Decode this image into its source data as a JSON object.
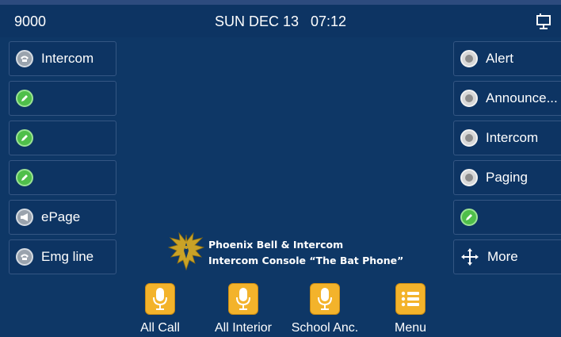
{
  "status_bar": {
    "extension": "9000",
    "datetime": "SUN DEC 13   07:12",
    "network_icon": "network-connected-icon"
  },
  "left_keys": [
    {
      "label": "Intercom",
      "icon": "phone-icon",
      "style": "grey"
    },
    {
      "label": "",
      "icon": "edit-icon",
      "style": "green"
    },
    {
      "label": "",
      "icon": "edit-icon",
      "style": "green"
    },
    {
      "label": "",
      "icon": "edit-icon",
      "style": "green"
    },
    {
      "label": "ePage",
      "icon": "megaphone-icon",
      "style": "grey"
    },
    {
      "label": "Emg line",
      "icon": "phone-icon",
      "style": "grey"
    }
  ],
  "right_keys": [
    {
      "label": "Alert",
      "icon": "radio-icon",
      "style": "white"
    },
    {
      "label": "Announce...",
      "icon": "radio-icon",
      "style": "white"
    },
    {
      "label": "Intercom",
      "icon": "radio-icon",
      "style": "white"
    },
    {
      "label": "Paging",
      "icon": "radio-icon",
      "style": "white"
    },
    {
      "label": "",
      "icon": "edit-icon",
      "style": "green"
    },
    {
      "label": "More",
      "icon": "move-arrows-icon",
      "style": "none"
    }
  ],
  "branding": {
    "line1": "Phoenix Bell & Intercom",
    "line2": "Intercom Console “The Bat Phone”"
  },
  "softkeys": [
    {
      "label": "All Call",
      "icon": "microphone-icon"
    },
    {
      "label": "All Interior",
      "icon": "microphone-icon"
    },
    {
      "label": "School Anc.",
      "icon": "microphone-icon"
    },
    {
      "label": "Menu",
      "icon": "menu-list-icon"
    }
  ],
  "colors": {
    "background": "#0e3766",
    "key_border": "#345683",
    "softkey_icon": "#f3b32b",
    "green_badge": "#4fbf4a",
    "logo_gold": "#c9a227"
  }
}
